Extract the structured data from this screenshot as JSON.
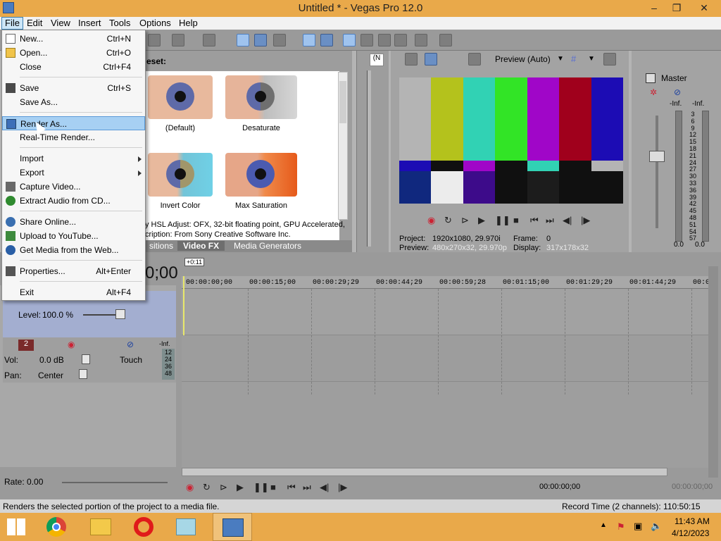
{
  "window": {
    "title": "Untitled * - Vegas Pro 12.0",
    "min": "–",
    "max": "❐",
    "close": "✕"
  },
  "menu": [
    "File",
    "Edit",
    "View",
    "Insert",
    "Tools",
    "Options",
    "Help"
  ],
  "file_menu": {
    "items": [
      {
        "label": "New...",
        "shortcut": "Ctrl+N"
      },
      {
        "label": "Open...",
        "shortcut": "Ctrl+O"
      },
      {
        "label": "Close",
        "shortcut": "Ctrl+F4"
      },
      {
        "label": "Save",
        "shortcut": "Ctrl+S"
      },
      {
        "label": "Save As...",
        "shortcut": ""
      },
      {
        "label": "Render As...",
        "shortcut": ""
      },
      {
        "label": "Real-Time Render...",
        "shortcut": ""
      },
      {
        "label": "Import",
        "shortcut": ""
      },
      {
        "label": "Export",
        "shortcut": ""
      },
      {
        "label": "Capture Video...",
        "shortcut": ""
      },
      {
        "label": "Extract Audio from CD...",
        "shortcut": ""
      },
      {
        "label": "Share Online...",
        "shortcut": ""
      },
      {
        "label": "Upload to YouTube...",
        "shortcut": ""
      },
      {
        "label": "Get Media from the Web...",
        "shortcut": ""
      },
      {
        "label": "Properties...",
        "shortcut": "Alt+Enter"
      },
      {
        "label": "Exit",
        "shortcut": "Alt+F4"
      }
    ]
  },
  "fx": {
    "preset_label": "eset:",
    "tiles": [
      {
        "caption": "(Default)"
      },
      {
        "caption": "Desaturate"
      },
      {
        "caption": "Invert Color"
      },
      {
        "caption": "Max Saturation"
      }
    ],
    "desc_line1": "y HSL Adjust: OFX, 32-bit floating point, GPU Accelerated,",
    "desc_line2": "cription: From Sony Creative Software Inc.",
    "tabs": [
      "sitions",
      "Video FX",
      "Media Generators"
    ]
  },
  "preview": {
    "mode": "Preview (Auto)",
    "project_label": "Project:",
    "project_value": "1920x1080, 29.970i",
    "preview_label": "Preview:",
    "preview_value": "480x270x32, 29.970p",
    "frame_label": "Frame:",
    "frame_value": "0",
    "display_label": "Display:",
    "display_value": "317x178x32",
    "bars_top": [
      "#b4b4b4",
      "#b4c21c",
      "#31d2b4",
      "#32e426",
      "#a006c8",
      "#a0001c",
      "#1c0cb4"
    ],
    "bars_mid": [
      "#1c0cb4",
      "#101010",
      "#a006c8",
      "#101010",
      "#31d2b4",
      "#101010",
      "#b4b4b4"
    ],
    "bars_bottom": [
      "#10287e",
      "#ececec",
      "#3d0b8a",
      "#101010",
      "#1c1c1c",
      "#101010",
      "#101010"
    ]
  },
  "master": {
    "title": "Master",
    "inf_left": "-Inf.",
    "inf_right": "-Inf.",
    "scale": [
      "3",
      "6",
      "9",
      "12",
      "15",
      "18",
      "21",
      "24",
      "27",
      "30",
      "33",
      "36",
      "39",
      "42",
      "45",
      "48",
      "51",
      "54",
      "57"
    ],
    "foot_left": "0.0",
    "foot_right": "0.0"
  },
  "timecode": {
    "big": "0;00",
    "offset": "+0:11"
  },
  "ruler": [
    "00:00:00;00",
    "00:00:15;00",
    "00:00:29;29",
    "00:00:44;29",
    "00:00:59;28",
    "00:01:15;00",
    "00:01:29;29",
    "00:01:44;29",
    "00:0"
  ],
  "video_track": {
    "level_label": "Level:",
    "level_value": "100.0 %"
  },
  "audio_track": {
    "number": "2",
    "vol_label": "Vol:",
    "vol_value": "0.0 dB",
    "pan_label": "Pan:",
    "pan_value": "Center",
    "automation": "Touch",
    "meter_inf": "-Inf.",
    "meter_scale": [
      "12",
      "24",
      "36",
      "48"
    ]
  },
  "rate": {
    "label": "Rate: 0.00"
  },
  "transport": {
    "time1": "00:00:00;00",
    "time2": "00:00:00;00"
  },
  "status": {
    "left": "Renders the selected portion of the project to a media file.",
    "right": "Record Time (2 channels): 110:50:15"
  },
  "taskbar": {
    "time": "11:43 AM",
    "date": "4/12/2023"
  }
}
